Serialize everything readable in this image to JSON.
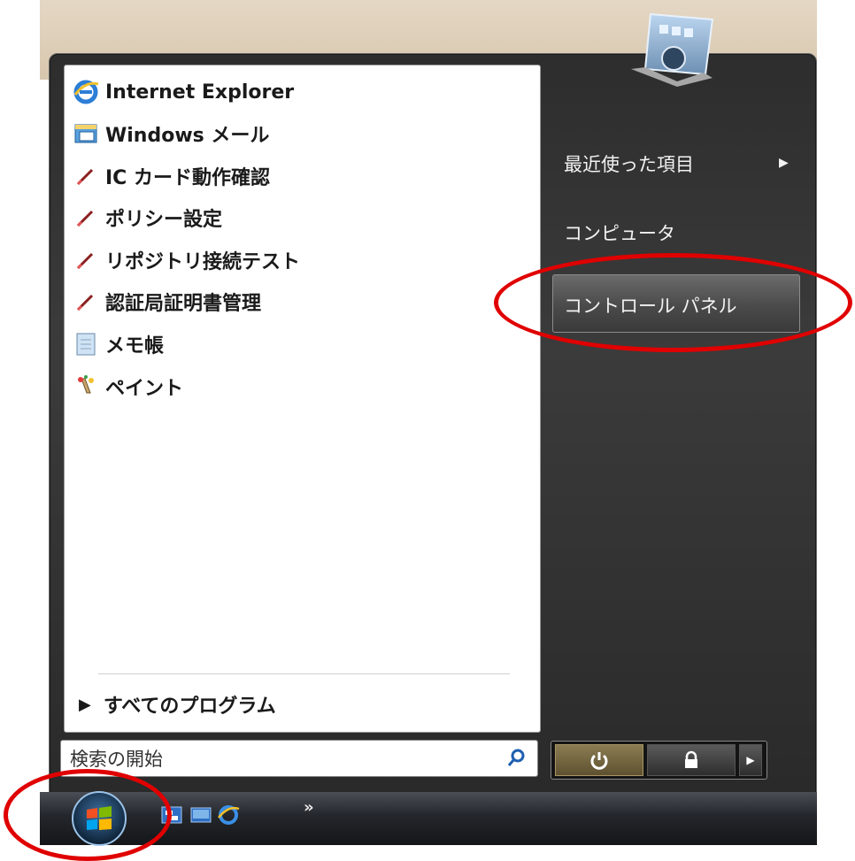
{
  "programs": [
    {
      "label": "Internet Explorer",
      "icon": "ie-icon"
    },
    {
      "label": "Windows メール",
      "icon": "mail-icon"
    },
    {
      "label": "IC カード動作確認",
      "icon": "pen-icon"
    },
    {
      "label": "ポリシー設定",
      "icon": "pen-icon"
    },
    {
      "label": "リポジトリ接続テスト",
      "icon": "pen-icon"
    },
    {
      "label": "認証局証明書管理",
      "icon": "pen-icon"
    },
    {
      "label": "メモ帳",
      "icon": "notepad-icon"
    },
    {
      "label": "ペイント",
      "icon": "paint-icon"
    }
  ],
  "all_programs_label": "すべてのプログラム",
  "search": {
    "placeholder": "検索の開始"
  },
  "right_menu": {
    "recent": "最近使った項目",
    "computer": "コンピュータ",
    "control_panel": "コントロール パネル"
  },
  "taskbar": {
    "more": "»"
  },
  "colors": {
    "highlight": "#e00000",
    "menu_bg": "#2d2d2d"
  }
}
